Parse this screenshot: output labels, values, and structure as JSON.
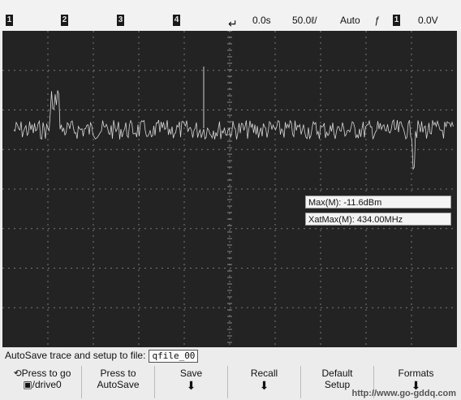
{
  "top_bar": {
    "channels": [
      "1",
      "2",
      "3",
      "4"
    ],
    "time_ref": "0.0s",
    "time_scale": "50.0ℓ/",
    "trigger_mode": "Auto",
    "trigger_slope_icon": "rising-edge-icon",
    "trigger_source": "1",
    "trigger_level": "0.0V"
  },
  "measurements": {
    "max": "Max(M): -11.6dBm",
    "xatmax": "XatMax(M): 434.00MHz"
  },
  "status": {
    "message": "AutoSave trace and setup to file:",
    "file_name": "qfile_00"
  },
  "softkeys": {
    "press_to_go": {
      "line1": "Press to go",
      "line2": "/drive0"
    },
    "autosave": {
      "line1": "Press to",
      "line2": "AutoSave"
    },
    "save": "Save",
    "recall": "Recall",
    "default_setup": {
      "line1": "Default",
      "line2": "Setup"
    },
    "formats": "Formats"
  },
  "watermark": "http://www.go-gddq.com"
}
